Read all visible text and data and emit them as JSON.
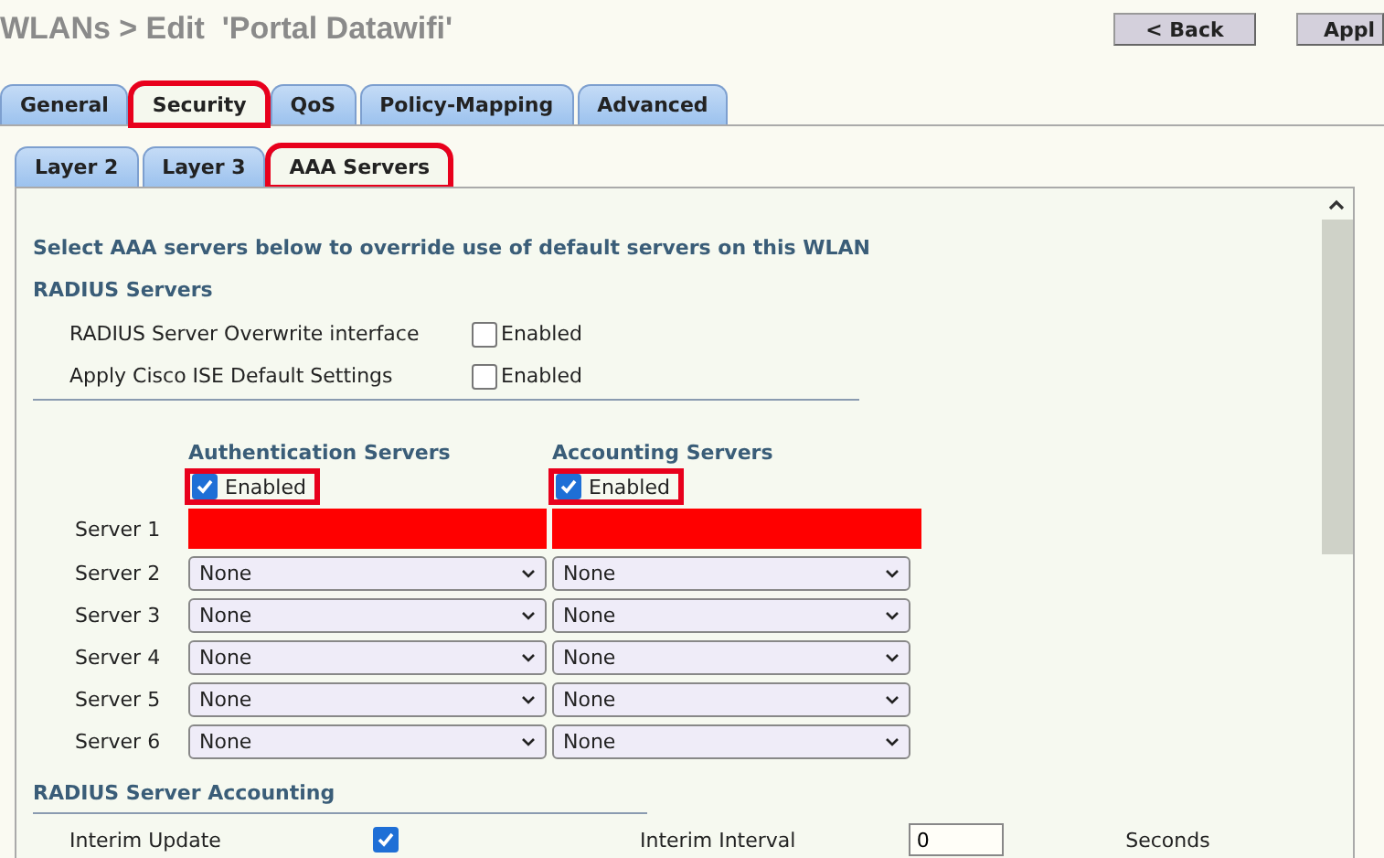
{
  "header": {
    "title": "WLANs > Edit  'Portal Datawifi'",
    "buttons": [
      "< Back",
      "Appl"
    ]
  },
  "tabs": [
    {
      "label": "General",
      "selected": false,
      "highlighted": false
    },
    {
      "label": "Security",
      "selected": true,
      "highlighted": true
    },
    {
      "label": "QoS",
      "selected": false,
      "highlighted": false
    },
    {
      "label": "Policy-Mapping",
      "selected": false,
      "highlighted": false
    },
    {
      "label": "Advanced",
      "selected": false,
      "highlighted": false
    }
  ],
  "subtabs": [
    {
      "label": "Layer 2",
      "selected": false,
      "highlighted": false
    },
    {
      "label": "Layer 3",
      "selected": false,
      "highlighted": false
    },
    {
      "label": "AAA Servers",
      "selected": true,
      "highlighted": true
    }
  ],
  "intro": "Select AAA servers below to override use of default servers on this WLAN",
  "radius_heading": "RADIUS Servers",
  "options": [
    {
      "label": "RADIUS Server Overwrite interface",
      "checkbox_label": "Enabled",
      "checked": false
    },
    {
      "label": "Apply Cisco ISE Default Settings",
      "checkbox_label": "Enabled",
      "checked": false
    }
  ],
  "columns": [
    {
      "heading": "Authentication Servers",
      "checkbox_label": "Enabled",
      "checked": true,
      "highlighted": true
    },
    {
      "heading": "Accounting Servers",
      "checkbox_label": "Enabled",
      "checked": true,
      "highlighted": true
    }
  ],
  "servers": [
    {
      "label": "Server 1",
      "redacted": true
    },
    {
      "label": "Server 2",
      "redacted": false,
      "values": [
        "None",
        "None"
      ]
    },
    {
      "label": "Server 3",
      "redacted": false,
      "values": [
        "None",
        "None"
      ]
    },
    {
      "label": "Server 4",
      "redacted": false,
      "values": [
        "None",
        "None"
      ]
    },
    {
      "label": "Server 5",
      "redacted": false,
      "values": [
        "None",
        "None"
      ]
    },
    {
      "label": "Server 6",
      "redacted": false,
      "values": [
        "None",
        "None"
      ]
    }
  ],
  "accounting": {
    "heading": "RADIUS Server Accounting",
    "interim_update": {
      "label": "Interim Update",
      "checked": true
    },
    "interim_interval": {
      "label": "Interim Interval",
      "value": "0",
      "unit": "Seconds"
    }
  }
}
